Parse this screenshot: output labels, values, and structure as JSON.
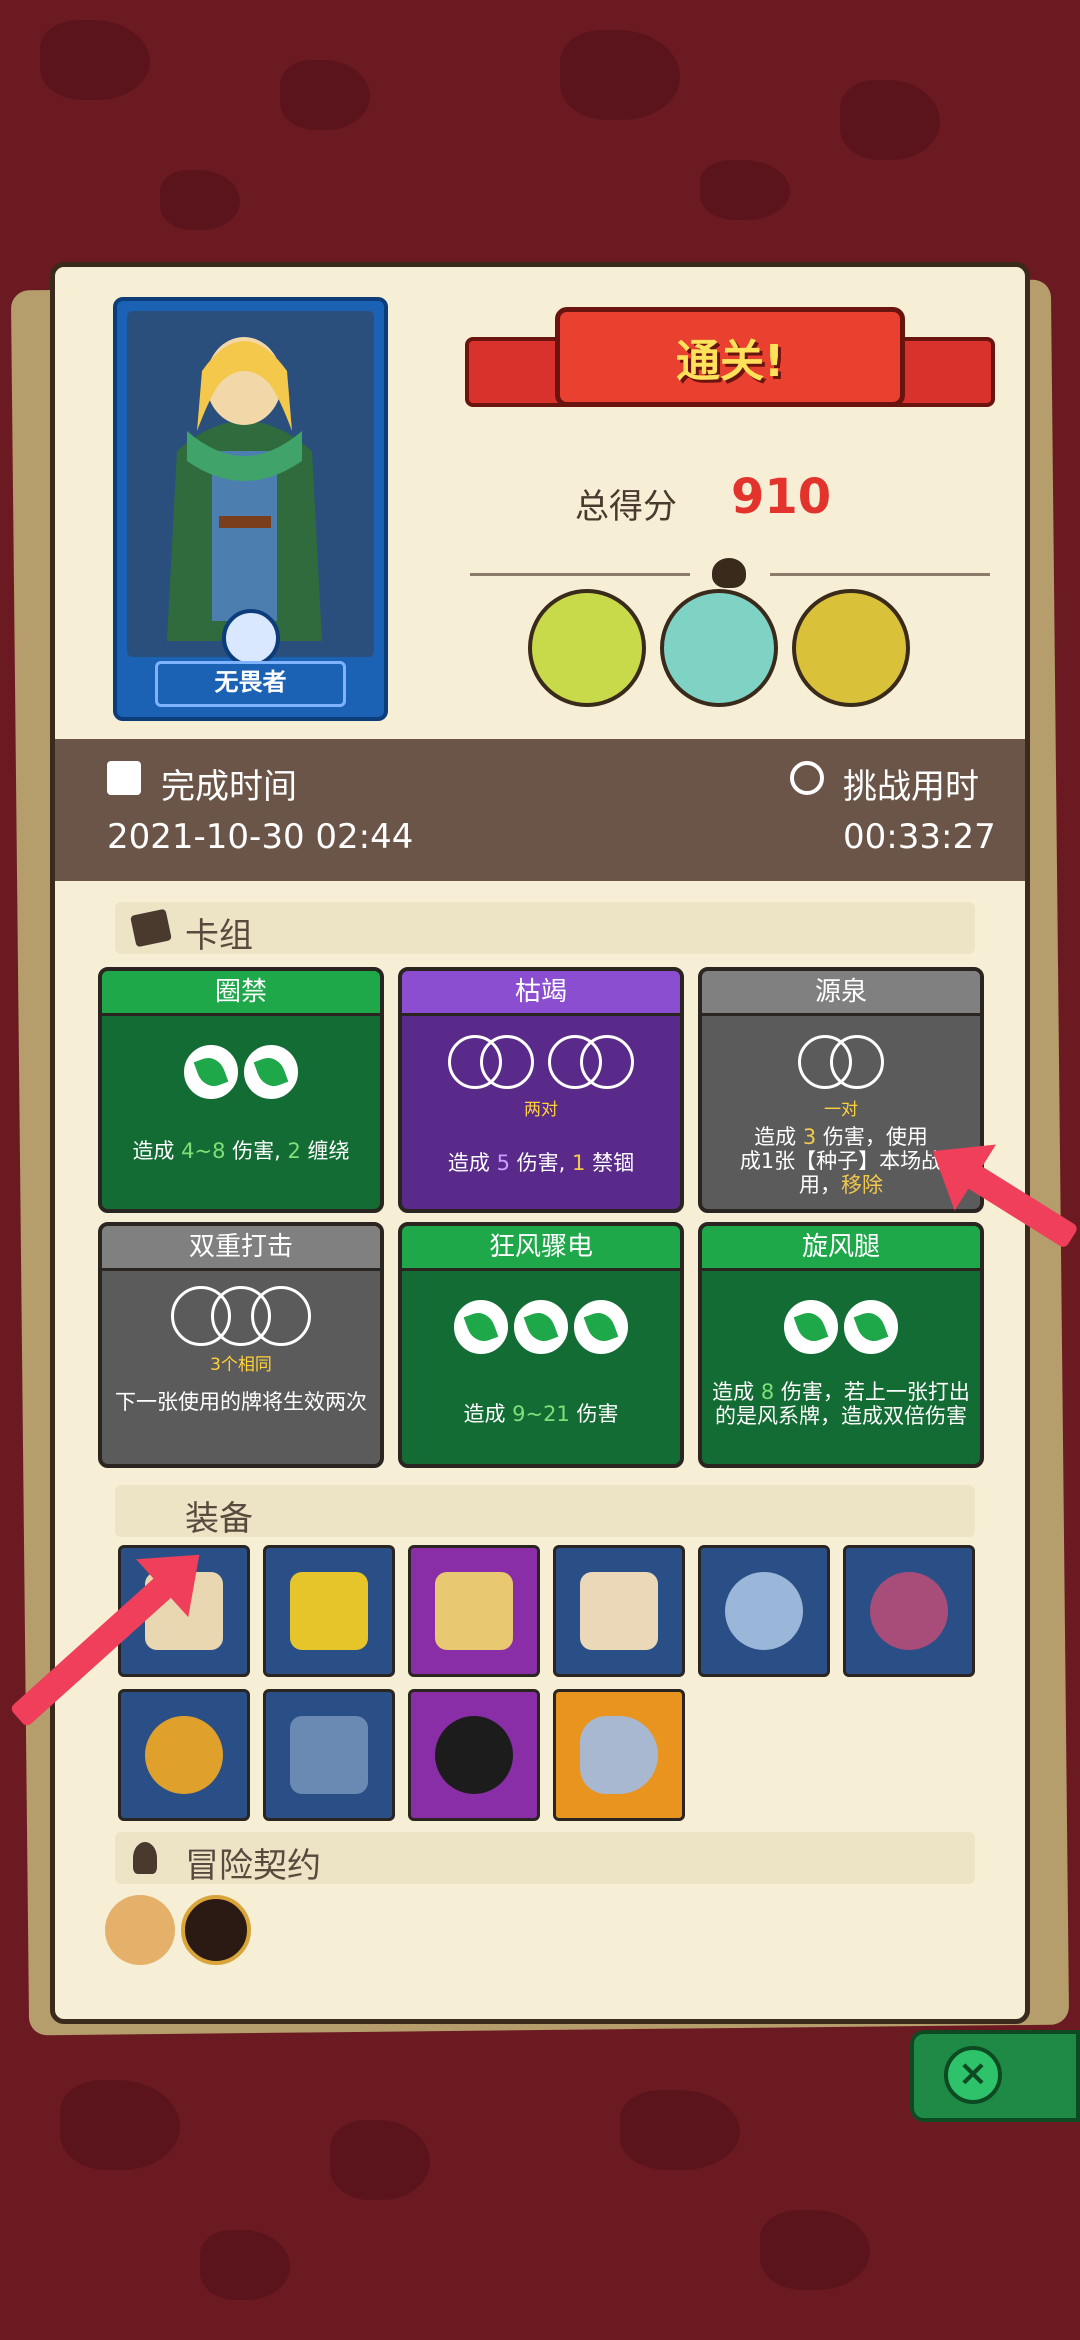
{
  "result": {
    "banner_title": "通关!",
    "score_label": "总得分",
    "score_value": "910"
  },
  "character": {
    "name": "无畏者"
  },
  "time": {
    "finish_label": "完成时间",
    "finish_value": "2021-10-30 02:44",
    "challenge_label": "挑战用时",
    "challenge_value": "00:33:27"
  },
  "sections": {
    "deck": "卡组",
    "equipment": "装备",
    "contract": "冒险契约"
  },
  "cards": [
    {
      "name": "圈禁",
      "color": "green",
      "slots": 2,
      "desc_parts": [
        "造成 ",
        "4~8",
        " 伤害, ",
        "2",
        " 缠绕"
      ]
    },
    {
      "name": "枯竭",
      "color": "purple",
      "combo": "两对",
      "desc_parts": [
        "造成 ",
        "5",
        " 伤害, ",
        "1",
        " 禁锢"
      ]
    },
    {
      "name": "源泉",
      "color": "gray",
      "combo": "一对",
      "desc_line1": "造成 ",
      "desc_num": "3",
      "desc_line1b": " 伤害，使用",
      "desc_line2": "成1张【种子】本场战",
      "desc_line3": "用，",
      "remove": "移除"
    },
    {
      "name": "双重打击",
      "color": "gray",
      "combo": "3个相同",
      "desc": "下一张使用的牌将生效两次"
    },
    {
      "name": "狂风骤电",
      "color": "green",
      "slots": 3,
      "desc_parts": [
        "造成 ",
        "9~21",
        " 伤害"
      ]
    },
    {
      "name": "旋风腿",
      "color": "green",
      "slots": 2,
      "desc_parts": [
        "造成 ",
        "8",
        " 伤害，若上一张打出的是风系牌，造成双倍伤害"
      ]
    }
  ],
  "equipment": [
    {
      "icon": "ice-scroll-icon",
      "color": "blue"
    },
    {
      "icon": "clover-box-icon",
      "color": "blue"
    },
    {
      "icon": "sword-scroll-icon",
      "color": "purple"
    },
    {
      "icon": "red-scroll-icon",
      "color": "blue"
    },
    {
      "icon": "star-gear-icon",
      "color": "blue"
    },
    {
      "icon": "swirl-shield-icon",
      "color": "blue"
    },
    {
      "icon": "golden-pot-icon",
      "color": "blue"
    },
    {
      "icon": "sickle-icon",
      "color": "blue"
    },
    {
      "icon": "dark-skull-icon",
      "color": "purple"
    },
    {
      "icon": "horn-icon",
      "color": "orange"
    }
  ],
  "colors": {
    "accent_red": "#e2342c",
    "banner_yellow": "#ffe25a",
    "card_green": "#1ea84a",
    "card_purple": "#8c4ed1",
    "card_gray": "#808080",
    "annotation_arrow": "#ef3f5a"
  }
}
